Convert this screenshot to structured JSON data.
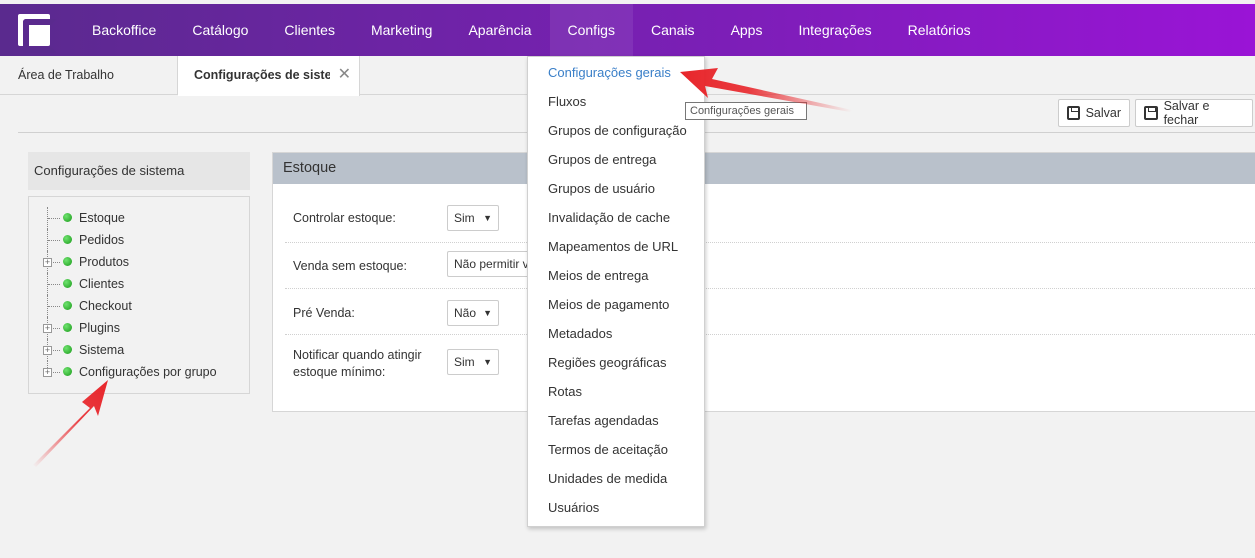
{
  "topnav": {
    "items": [
      {
        "label": "Backoffice"
      },
      {
        "label": "Catálogo"
      },
      {
        "label": "Clientes"
      },
      {
        "label": "Marketing"
      },
      {
        "label": "Aparência"
      },
      {
        "label": "Configs"
      },
      {
        "label": "Canais"
      },
      {
        "label": "Apps"
      },
      {
        "label": "Integrações"
      },
      {
        "label": "Relatórios"
      }
    ],
    "active": "Configs"
  },
  "tabs": {
    "desktop": "Área de Trabalho",
    "config": "Configurações de sistema"
  },
  "toolbar": {
    "save": "Salvar",
    "save_close": "Salvar e fechar"
  },
  "sidebar": {
    "title": "Configurações de sistema",
    "items": [
      {
        "label": "Estoque",
        "expandable": false
      },
      {
        "label": "Pedidos",
        "expandable": false
      },
      {
        "label": "Produtos",
        "expandable": true
      },
      {
        "label": "Clientes",
        "expandable": false
      },
      {
        "label": "Checkout",
        "expandable": false
      },
      {
        "label": "Plugins",
        "expandable": true
      },
      {
        "label": "Sistema",
        "expandable": true
      },
      {
        "label": "Configurações por grupo",
        "expandable": true
      }
    ]
  },
  "panel": {
    "title": "Estoque",
    "fields": [
      {
        "label": "Controlar estoque:",
        "value": "Sim"
      },
      {
        "label": "Venda sem estoque:",
        "value": "Não permitir v"
      },
      {
        "label": "Pré Venda:",
        "value": "Não"
      },
      {
        "label": "Notificar quando atingir estoque mínimo:",
        "value": "Sim"
      }
    ]
  },
  "menu": {
    "items": [
      {
        "label": "Configurações gerais"
      },
      {
        "label": "Fluxos"
      },
      {
        "label": "Grupos de configuração"
      },
      {
        "label": "Grupos de entrega"
      },
      {
        "label": "Grupos de usuário"
      },
      {
        "label": "Invalidação de cache"
      },
      {
        "label": "Mapeamentos de URL"
      },
      {
        "label": "Meios de entrega"
      },
      {
        "label": "Meios de pagamento"
      },
      {
        "label": "Metadados"
      },
      {
        "label": "Regiões geográficas"
      },
      {
        "label": "Rotas"
      },
      {
        "label": "Tarefas agendadas"
      },
      {
        "label": "Termos de aceitação"
      },
      {
        "label": "Unidades de medida"
      },
      {
        "label": "Usuários"
      }
    ],
    "highlighted": "Configurações gerais"
  },
  "tooltip": "Configurações gerais",
  "colors": {
    "nav_start": "#5a2a8e",
    "nav_end": "#9a14d6",
    "menu_active": "#3a7fc8",
    "status_dot": "#1a9a1a",
    "arrow": "#e8262b"
  }
}
